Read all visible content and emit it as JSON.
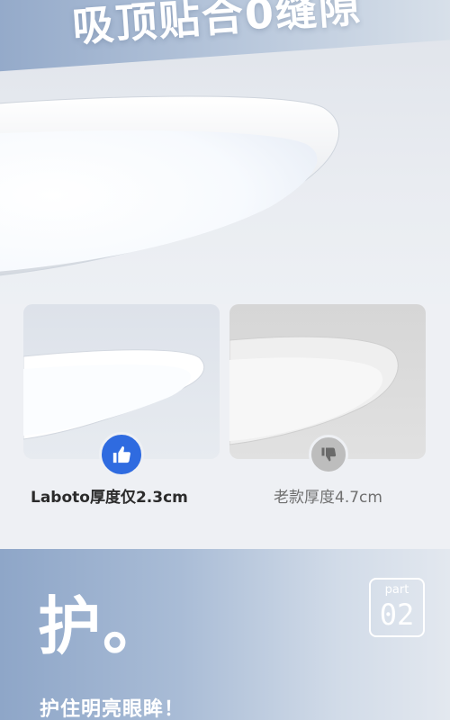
{
  "hero": {
    "title": "吸顶贴合0缝隙"
  },
  "compare": {
    "left": {
      "caption": "Laboto厚度仅2.3cm",
      "icon": "thumbs-up-icon",
      "accent": "#2f6be0"
    },
    "right": {
      "caption": "老款厚度4.7cm",
      "icon": "thumbs-down-icon",
      "accent": "#bdbdbd"
    }
  },
  "part2": {
    "word": "part",
    "number": "02",
    "big_char": "护。",
    "subtitle": "护住明亮眼眸！"
  }
}
